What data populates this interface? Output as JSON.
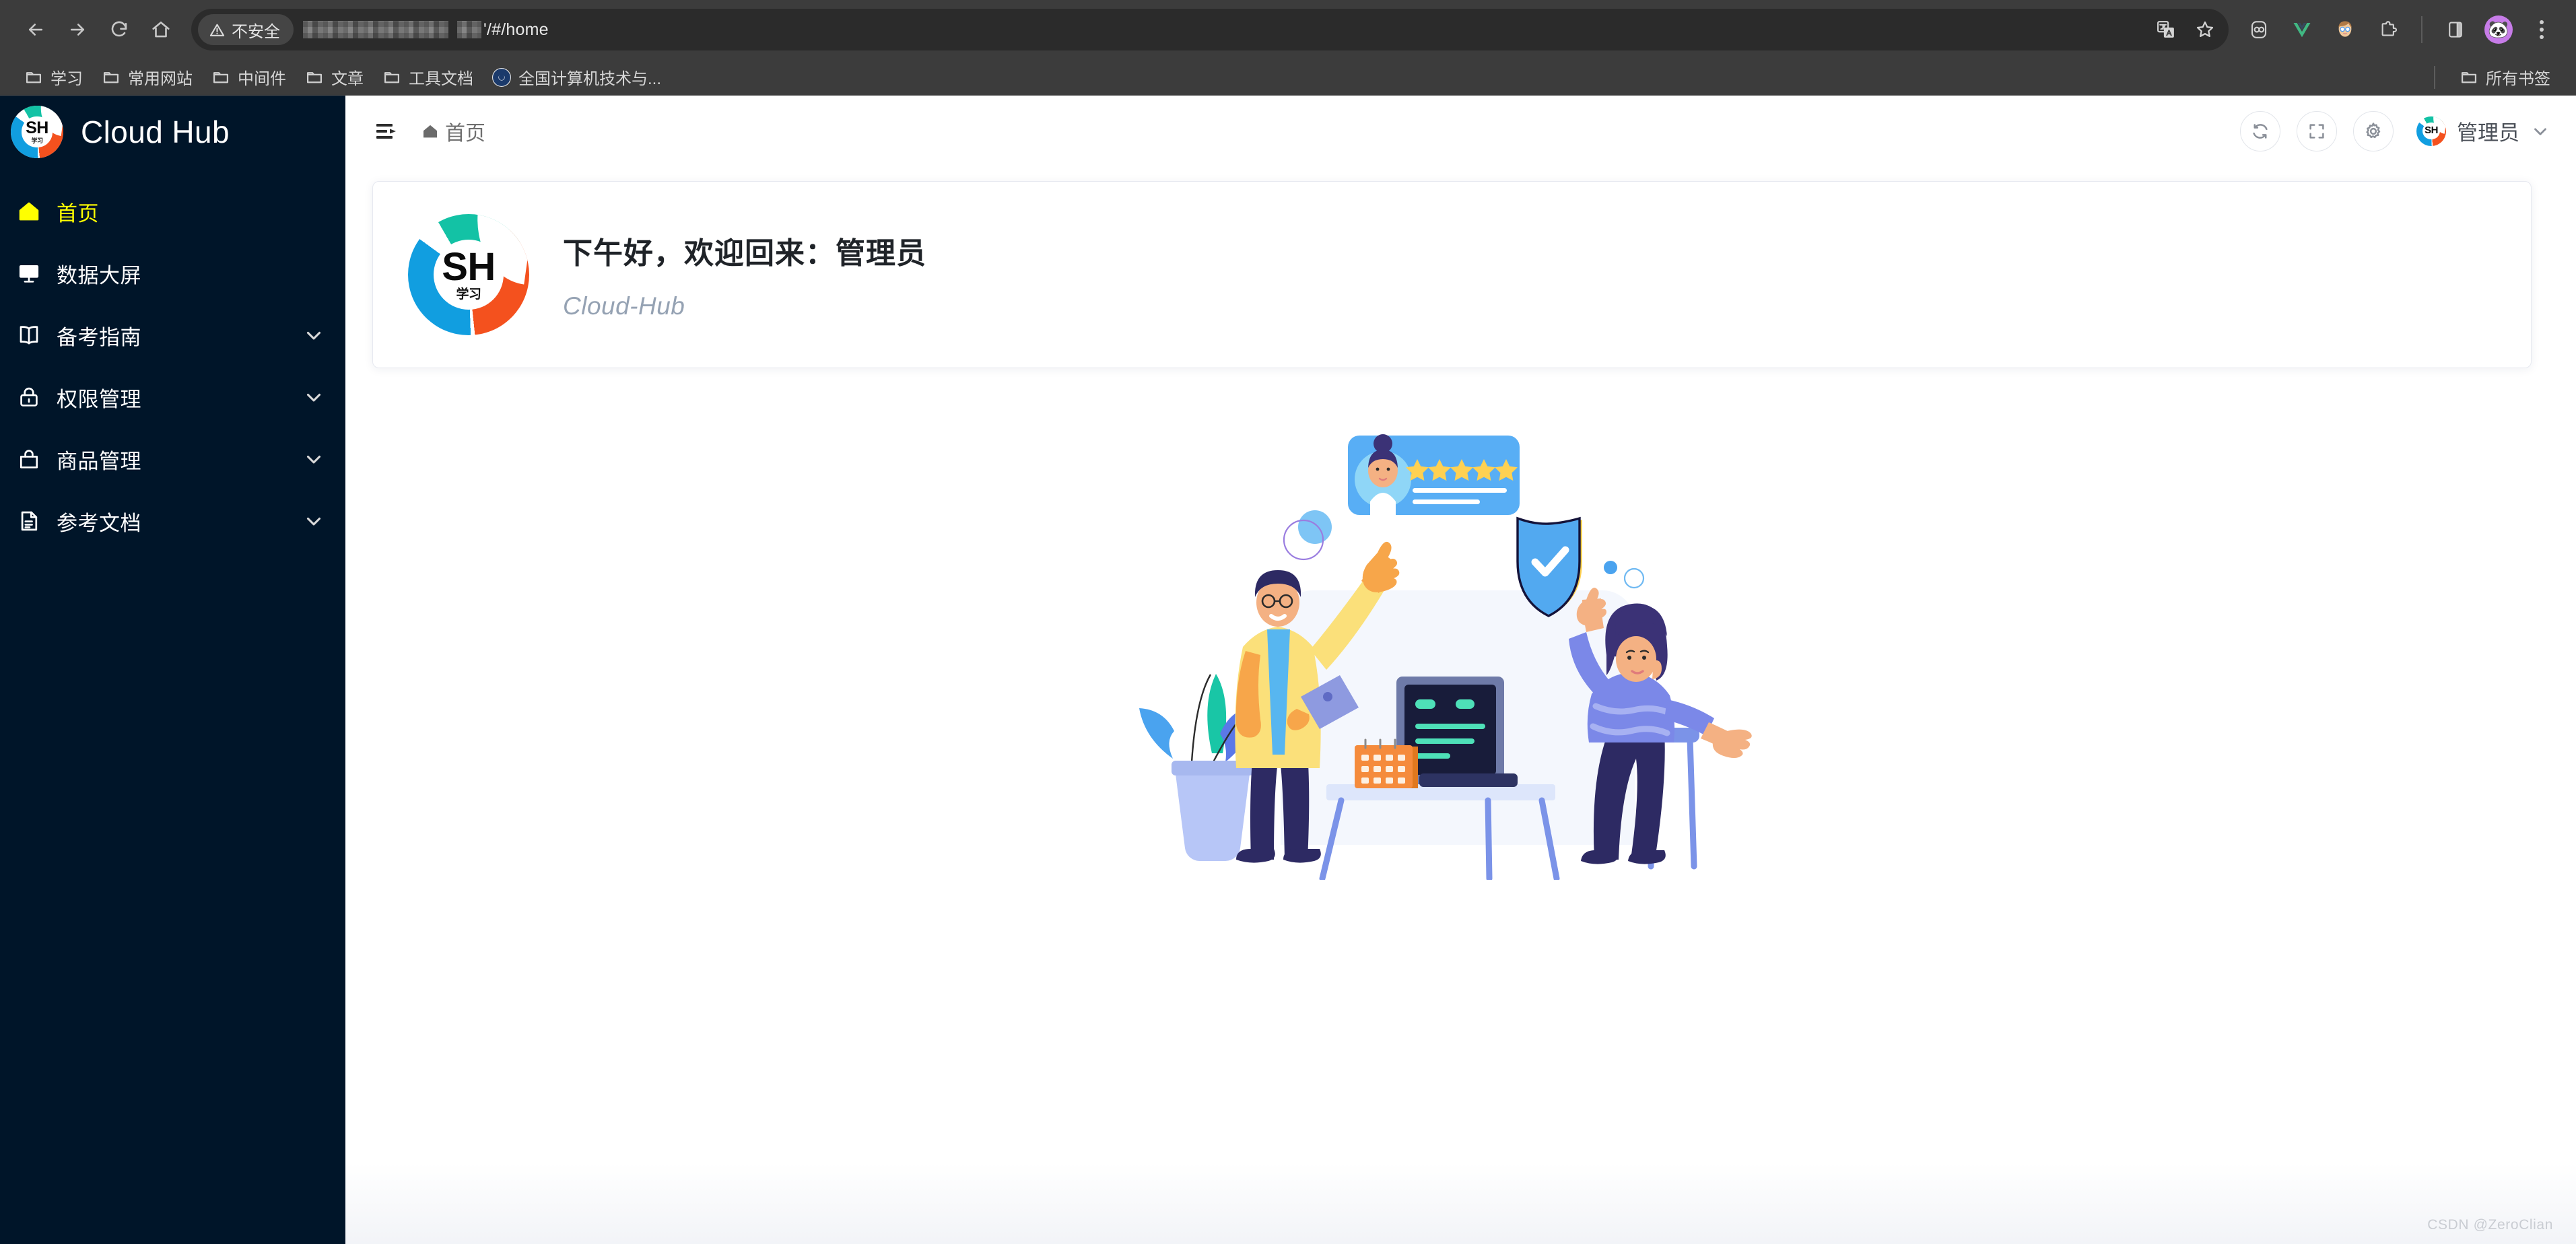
{
  "browser": {
    "nav": {
      "back": "Back",
      "forward": "Forward",
      "reload": "Reload",
      "home": "Home"
    },
    "omnibox": {
      "security_label": "不安全",
      "url_suffix": "'/#/home",
      "url_redacted": true
    },
    "toolbar_icons": [
      "translate-icon",
      "bookmark-star-icon",
      "extension-pocket-icon",
      "extension-vue-devtools-icon",
      "extension-avatar-icon",
      "extensions-puzzle-icon",
      "side-panel-icon",
      "profile-avatar-icon",
      "chrome-menu-icon"
    ],
    "bookmarks": [
      {
        "label": "学习",
        "icon": "folder-icon"
      },
      {
        "label": "常用网站",
        "icon": "folder-icon"
      },
      {
        "label": "中间件",
        "icon": "folder-icon"
      },
      {
        "label": "文章",
        "icon": "folder-icon"
      },
      {
        "label": "工具文档",
        "icon": "folder-icon"
      },
      {
        "label": "全国计算机技术与...",
        "icon": "site-favicon"
      }
    ],
    "all_bookmarks_label": "所有书签"
  },
  "sidebar": {
    "brand": "Cloud Hub",
    "logo_primary": "SH",
    "logo_sub": "学习",
    "items": [
      {
        "label": "首页",
        "icon": "home-icon",
        "active": true,
        "expandable": false
      },
      {
        "label": "数据大屏",
        "icon": "monitor-icon",
        "active": false,
        "expandable": false
      },
      {
        "label": "备考指南",
        "icon": "book-icon",
        "active": false,
        "expandable": true
      },
      {
        "label": "权限管理",
        "icon": "lock-icon",
        "active": false,
        "expandable": true
      },
      {
        "label": "商品管理",
        "icon": "bag-icon",
        "active": false,
        "expandable": true
      },
      {
        "label": "参考文档",
        "icon": "document-icon",
        "active": false,
        "expandable": true
      }
    ]
  },
  "topbar": {
    "collapse_icon": "menu-collapse-icon",
    "breadcrumb": "首页",
    "actions": [
      {
        "name": "refresh-button",
        "icon": "refresh-icon"
      },
      {
        "name": "fullscreen-button",
        "icon": "fullscreen-icon"
      },
      {
        "name": "settings-button",
        "icon": "gear-icon"
      }
    ],
    "user_name": "管理员",
    "user_avatar_text": "SH"
  },
  "welcome": {
    "greeting": "下午好，欢迎回来：管理员",
    "subtitle": "Cloud-Hub",
    "logo_primary": "SH",
    "logo_sub": "学习"
  },
  "illustration": {
    "name": "team-workspace-illustration",
    "review_card_stars": 5,
    "shield_status": "verified"
  },
  "watermark": "CSDN @ZeroClian",
  "colors": {
    "sidebar_bg": "#001529",
    "active_item": "#ffff00",
    "chrome_bg": "#3c3c3c",
    "omnibox_bg": "#2b2b2b",
    "content_bg": "#ffffff",
    "card_border": "#e7e9f0",
    "accent_blue": "#4a9bf5",
    "accent_yellow": "#ffd152",
    "logo_teal": "#13c2a5",
    "logo_blue": "#119ee0",
    "logo_orange": "#f4511e"
  }
}
